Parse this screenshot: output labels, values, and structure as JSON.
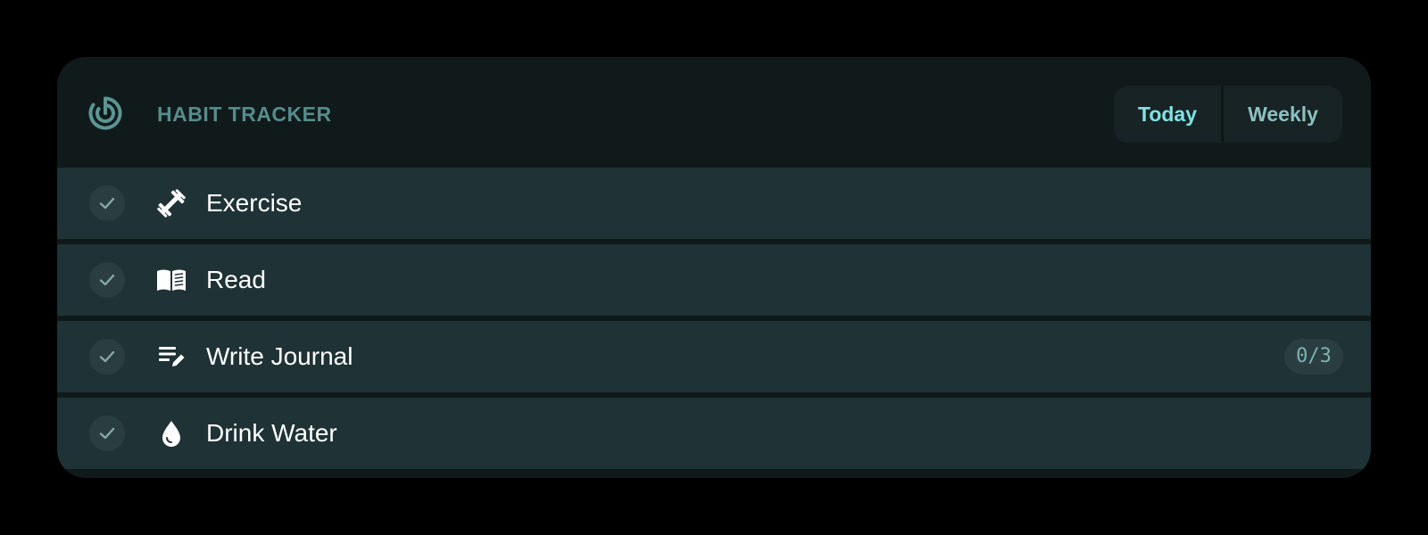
{
  "header": {
    "title": "HABIT TRACKER",
    "logo_icon": "target-icon",
    "tabs": [
      {
        "label": "Today",
        "active": true
      },
      {
        "label": "Weekly",
        "active": false
      }
    ]
  },
  "habits": [
    {
      "label": "Exercise",
      "icon": "dumbbell-icon",
      "done": false
    },
    {
      "label": "Read",
      "icon": "book-icon",
      "done": false
    },
    {
      "label": "Write Journal",
      "icon": "edit-note-icon",
      "done": false,
      "progress": "0/3"
    },
    {
      "label": "Drink Water",
      "icon": "water-drop-icon",
      "done": false
    }
  ],
  "colors": {
    "background": "#000000",
    "card": "#111a1a",
    "row": "#1f3236",
    "accent": "#7fe3e3",
    "muted": "#568c8c"
  }
}
